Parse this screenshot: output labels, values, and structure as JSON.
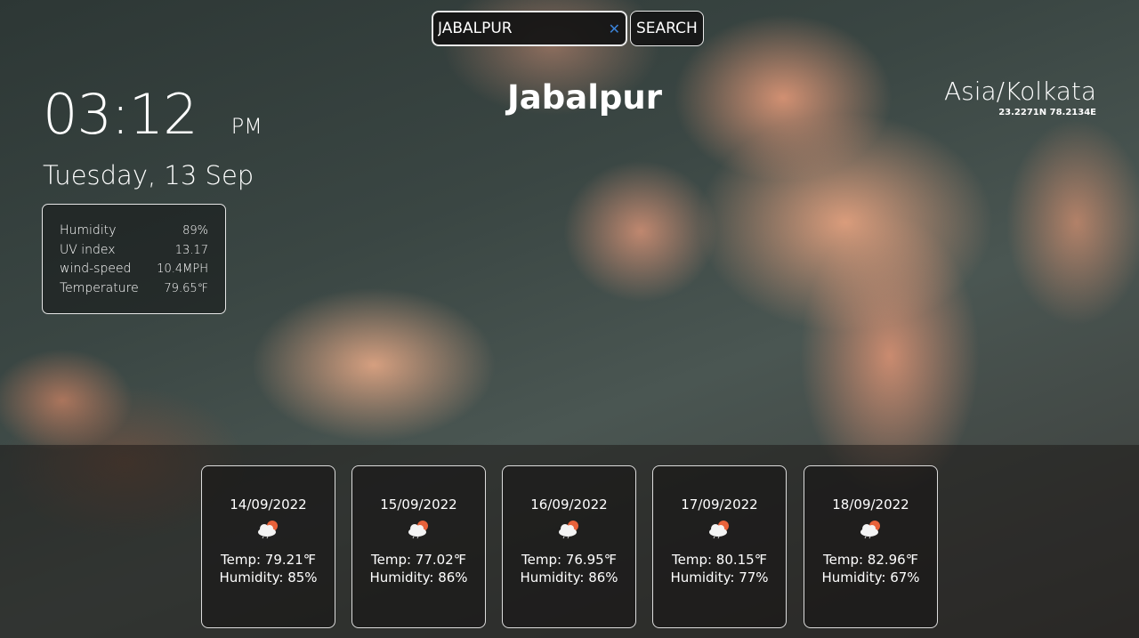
{
  "search": {
    "value": "JABALPUR",
    "button_label": "SEARCH",
    "clear_icon": "close-icon"
  },
  "clock": {
    "time": "03:12",
    "ampm": "PM",
    "date": "Tuesday, 13 Sep"
  },
  "current": [
    {
      "label": "Humidity",
      "value": "89%"
    },
    {
      "label": "UV index",
      "value": "13.17"
    },
    {
      "label": "wind-speed",
      "value": "10.4MPH"
    },
    {
      "label": "Temperature",
      "value": "79.65℉"
    }
  ],
  "location": {
    "city": "Jabalpur",
    "timezone": "Asia/Kolkata",
    "coords": "23.2271N 78.2134E"
  },
  "forecast": [
    {
      "date": "14/09/2022",
      "icon": "cloud-sun-icon",
      "temp": "Temp: 79.21℉",
      "humidity": "Humidity: 85%"
    },
    {
      "date": "15/09/2022",
      "icon": "cloud-sun-icon",
      "temp": "Temp: 77.02℉",
      "humidity": "Humidity: 86%"
    },
    {
      "date": "16/09/2022",
      "icon": "cloud-sun-icon",
      "temp": "Temp: 76.95℉",
      "humidity": "Humidity: 86%"
    },
    {
      "date": "17/09/2022",
      "icon": "cloud-sun-icon",
      "temp": "Temp: 80.15℉",
      "humidity": "Humidity: 77%"
    },
    {
      "date": "18/09/2022",
      "icon": "cloud-sun-icon",
      "temp": "Temp: 82.96℉",
      "humidity": "Humidity: 67%"
    }
  ],
  "colors": {
    "clear_icon": "#3b82d6",
    "sun": "#e8623a"
  }
}
